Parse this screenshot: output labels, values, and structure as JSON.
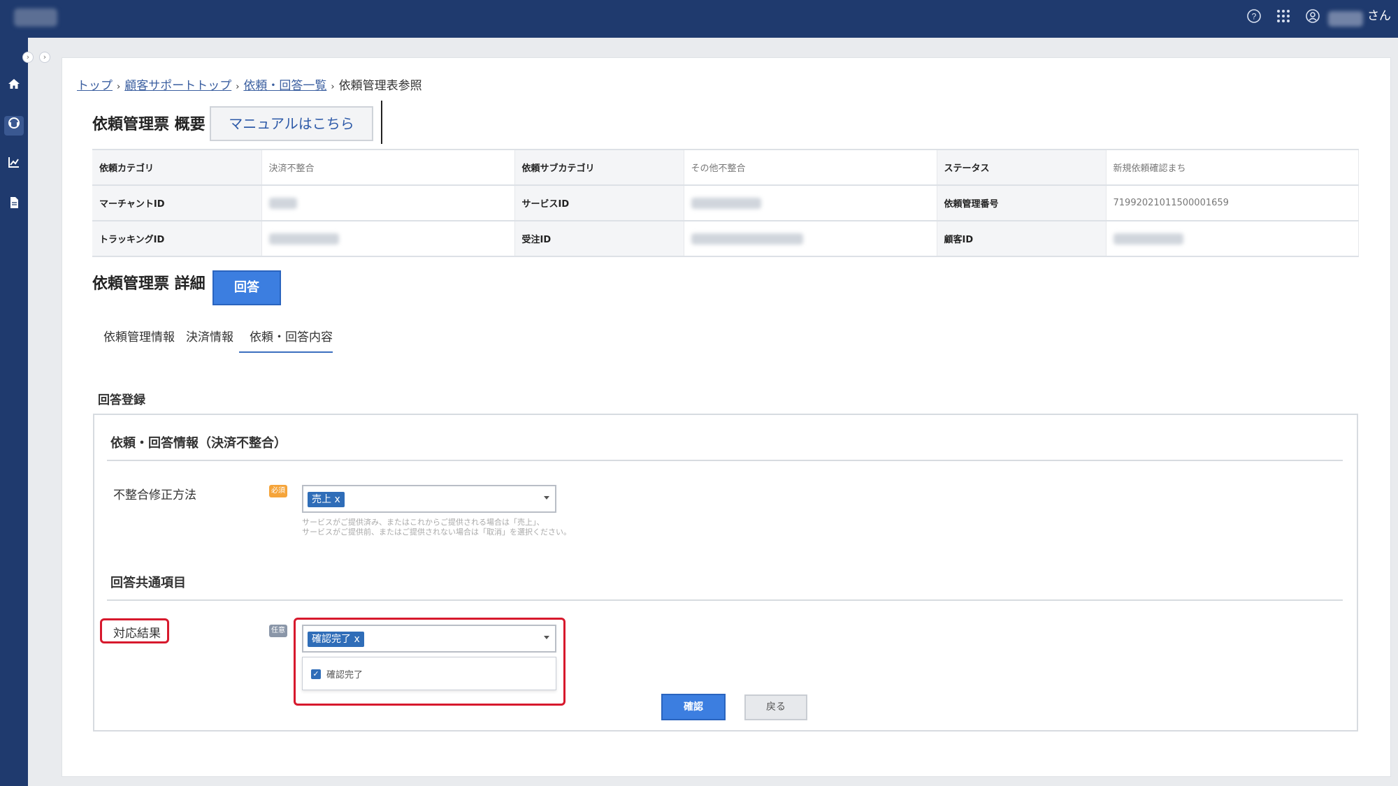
{
  "header": {
    "logo_icon": "app-logo",
    "icons": [
      "help-icon",
      "apps-grid-icon",
      "user-icon"
    ],
    "user_suffix": "さん"
  },
  "sidebar": {
    "items": [
      "home-icon",
      "support-icon",
      "chart-icon",
      "document-icon"
    ],
    "active": "support-icon"
  },
  "breadcrumb": {
    "items": [
      "トップ",
      "顧客サポートトップ",
      "依頼・回答一覧"
    ],
    "current": "依頼管理表参照",
    "separator": "›"
  },
  "summary": {
    "title": "依頼管理票 概要",
    "manual_button": "マニュアルはこちら",
    "rows": [
      [
        {
          "label": "依頼カテゴリ",
          "value": "決済不整合"
        },
        {
          "label": "依頼サブカテゴリ",
          "value": "その他不整合"
        },
        {
          "label": "ステータス",
          "value": "新規依頼確認まち"
        }
      ],
      [
        {
          "label": "マーチャントID",
          "value": ""
        },
        {
          "label": "サービスID",
          "value": ""
        },
        {
          "label": "依頼管理番号",
          "value": "71992021011500001659"
        }
      ],
      [
        {
          "label": "トラッキングID",
          "value": ""
        },
        {
          "label": "受注ID",
          "value": ""
        },
        {
          "label": "顧客ID",
          "value": ""
        }
      ]
    ]
  },
  "detail": {
    "title": "依頼管理票 詳細",
    "answer_button": "回答",
    "tabs": [
      "依頼管理情報",
      "決済情報",
      "依頼・回答内容"
    ],
    "active_tab": 2
  },
  "form": {
    "section_label": "回答登録",
    "group1_title": "依頼・回答情報（決済不整合）",
    "field1": {
      "label": "不整合修正方法",
      "badge": "必須",
      "selected": "売上 x",
      "help_line1": "サービスがご提供済み、またはこれからご提供される場合は「売上」、",
      "help_line2": "サービスがご提供前、またはご提供されない場合は「取消」を選択ください。"
    },
    "group2_title": "回答共通項目",
    "field2": {
      "label": "対応結果",
      "badge": "任意",
      "selected": "確認完了 x",
      "options": [
        {
          "label": "確認完了",
          "checked": true
        }
      ]
    },
    "confirm_button": "確認",
    "back_button": "戻る"
  },
  "colors": {
    "header_bg": "#1f3a6e",
    "primary_button": "#3c7ee0",
    "highlight_red": "#d7192d",
    "required_badge": "#f5a43a"
  }
}
